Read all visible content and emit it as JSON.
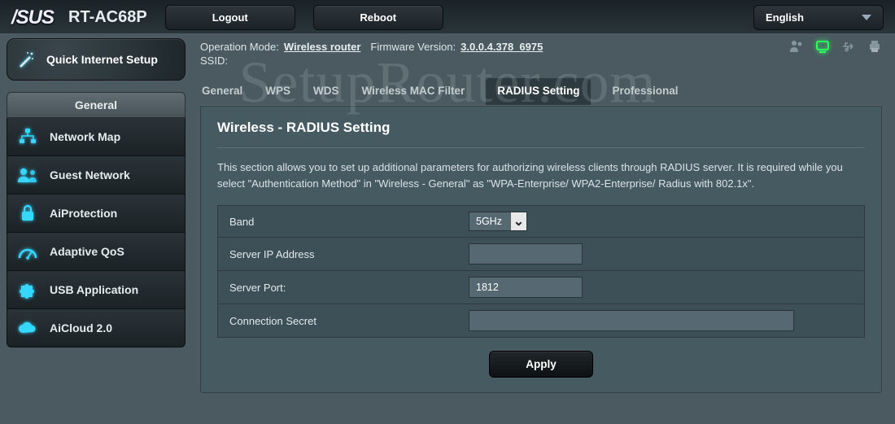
{
  "header": {
    "brand": "/SUS",
    "model": "RT-AC68P",
    "logout": "Logout",
    "reboot": "Reboot",
    "language": "English"
  },
  "status": {
    "op_mode_label": "Operation Mode:",
    "op_mode_value": "Wireless router",
    "fw_label": "Firmware Version:",
    "fw_value": "3.0.0.4.378_6975",
    "ssid_label": "SSID:",
    "ssid_value": ""
  },
  "sidebar": {
    "qis": "Quick Internet Setup",
    "section": "General",
    "items": [
      {
        "label": "Network Map"
      },
      {
        "label": "Guest Network"
      },
      {
        "label": "AiProtection"
      },
      {
        "label": "Adaptive QoS"
      },
      {
        "label": "USB Application"
      },
      {
        "label": "AiCloud 2.0"
      }
    ]
  },
  "tabs": [
    "General",
    "WPS",
    "WDS",
    "Wireless MAC Filter",
    "RADIUS Setting",
    "Professional"
  ],
  "active_tab": 4,
  "panel": {
    "title": "Wireless - RADIUS Setting",
    "description": "This section allows you to set up additional parameters for authorizing wireless clients through RADIUS server. It is required while you select \"Authentication Method\" in \"Wireless - General\" as \"WPA-Enterprise/ WPA2-Enterprise/ Radius with 802.1x\".",
    "fields": {
      "band_label": "Band",
      "band_value": "5GHz",
      "server_ip_label": "Server IP Address",
      "server_ip_value": "",
      "server_port_label": "Server Port:",
      "server_port_value": "1812",
      "secret_label": "Connection Secret",
      "secret_value": ""
    },
    "apply": "Apply"
  },
  "watermark": "SetupRouter.com"
}
